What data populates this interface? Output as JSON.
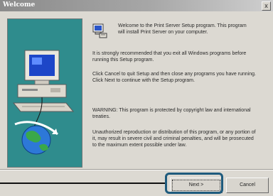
{
  "window": {
    "title": "Welcome",
    "close_label": "x"
  },
  "content": {
    "welcome_text": "Welcome to the Print Server Setup program.  This program will install Print Server on your computer.",
    "p1": "It is strongly recommended that you exit all Windows programs before running this Setup program.",
    "p2": "Click Cancel to quit Setup and then close any programs you have running.  Click Next to continue with the Setup program.",
    "p3": "WARNING: This program is protected by copyright law and international treaties.",
    "p4": "Unauthorized reproduction or distribution of this program, or any portion of it, may result in severe civil and criminal penalties, and will be prosecuted to the maximum extent possible under law."
  },
  "buttons": {
    "next": "Next >",
    "cancel": "Cancel"
  },
  "colors": {
    "panel": "#2f8c8d",
    "highlight": "#1f5b7d"
  },
  "icons": {
    "setup": "setup-computer-icon",
    "illustration": "computer-globe-illustration"
  }
}
